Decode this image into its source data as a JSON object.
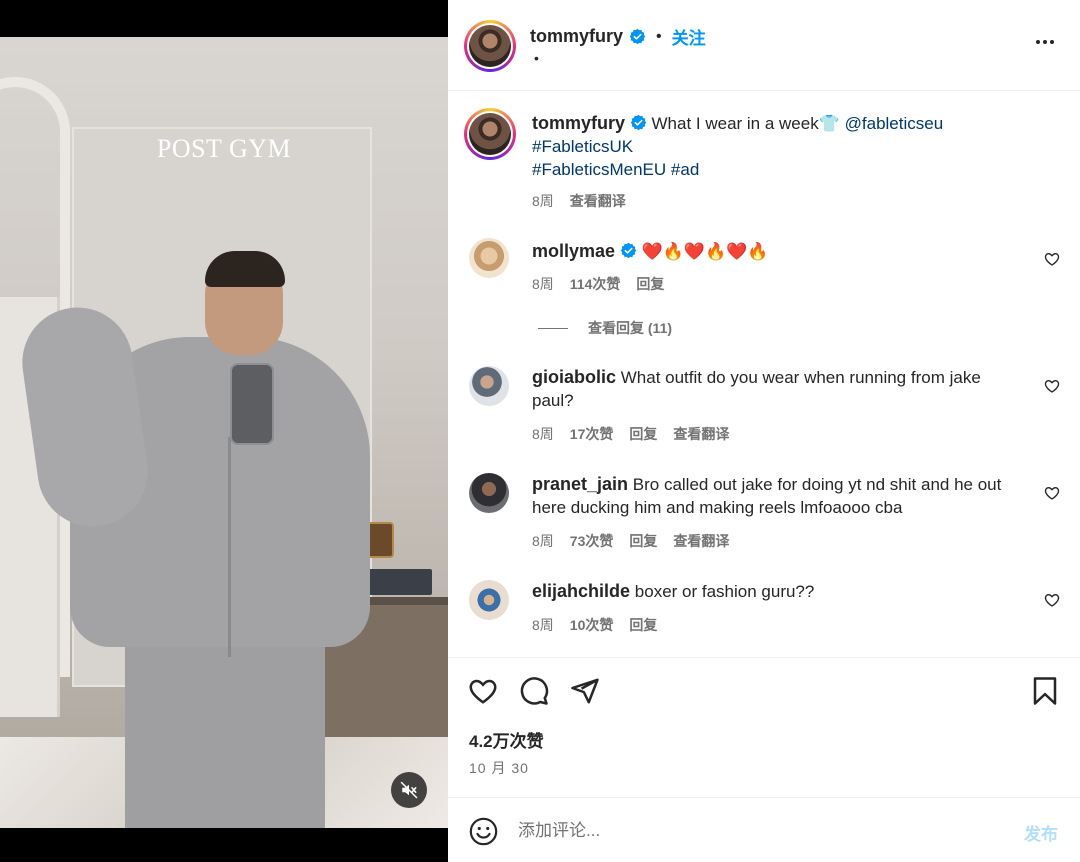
{
  "media": {
    "overlay_text": "POST GYM",
    "mute_icon": "speaker-muted-icon"
  },
  "header": {
    "username": "tommyfury",
    "separator": "•",
    "follow_label": "关注",
    "sub_text": "•",
    "more_icon": "more-horizontal-icon"
  },
  "caption": {
    "username": "tommyfury",
    "text": "What I wear in a week",
    "emoji": "👕",
    "mention": "@fableticseu",
    "hashtag1": "#FableticsUK",
    "hashtag2": "#FableticsMenEU",
    "hashtag3": "#ad",
    "age": "8周",
    "translate": "查看翻译"
  },
  "comments": [
    {
      "username": "mollymae",
      "verified": true,
      "text": "❤️🔥❤️🔥❤️🔥",
      "age": "8周",
      "likes": "114次赞",
      "reply": "回复",
      "view_replies": "查看回复 (11)"
    },
    {
      "username": "gioiabolic",
      "text": "What outfit do you wear when running from jake paul?",
      "age": "8周",
      "likes": "17次赞",
      "reply": "回复",
      "translate": "查看翻译"
    },
    {
      "username": "pranet_jain",
      "text": "Bro called out jake for doing yt nd shit and he out here ducking him and making reels lmfoaooo cba",
      "age": "8周",
      "likes": "73次赞",
      "reply": "回复",
      "translate": "查看翻译"
    },
    {
      "username": "elijahchilde",
      "text": "boxer or fashion guru??",
      "age": "8周",
      "likes": "10次赞",
      "reply": "回复"
    }
  ],
  "actions": {
    "likes_count": "4.2万次赞",
    "date": "10 月 30"
  },
  "comment_box": {
    "placeholder": "添加评论...",
    "post_label": "发布"
  },
  "colors": {
    "accent": "#0095f6",
    "link": "#00376b",
    "muted": "#737373",
    "post_disabled": "#b2dffc",
    "verified": "#0095f6"
  }
}
